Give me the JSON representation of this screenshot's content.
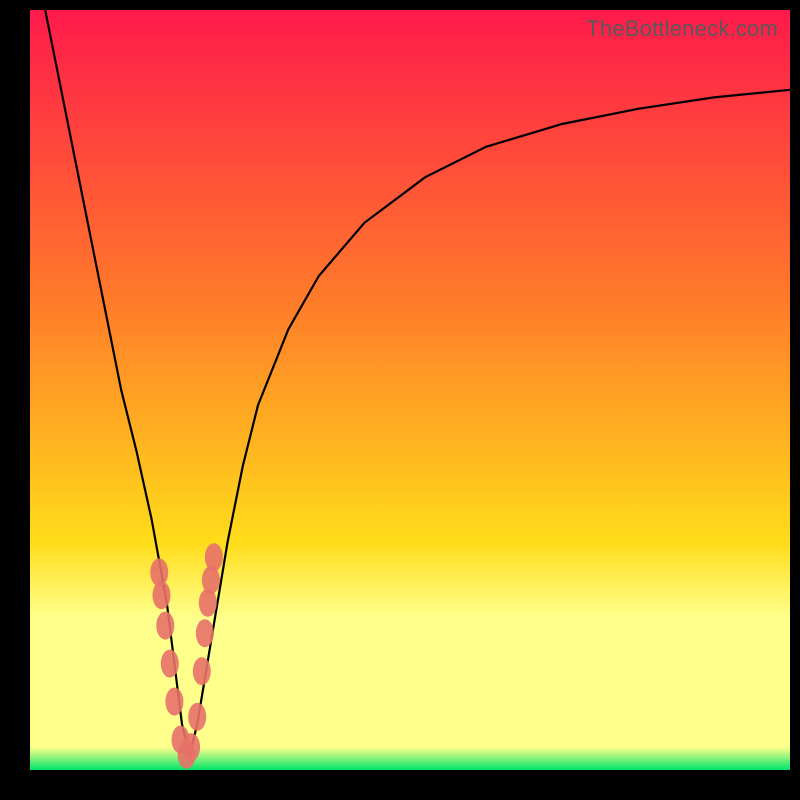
{
  "watermark": "TheBottleneck.com",
  "colors": {
    "top": "#ff1a4b",
    "mid_high": "#ff7a2a",
    "mid": "#ffdc1a",
    "pale_band": "#ffff8c",
    "bottom": "#00e56a",
    "frame": "#000000",
    "curve": "#000000",
    "marker": "#e77168"
  },
  "chart_data": {
    "type": "line",
    "title": "",
    "xlabel": "",
    "ylabel": "",
    "xlim": [
      0,
      100
    ],
    "ylim": [
      0,
      100
    ],
    "annotations": [
      "TheBottleneck.com"
    ],
    "series": [
      {
        "name": "bottleneck-curve",
        "x": [
          2,
          4,
          6,
          8,
          10,
          12,
          14,
          16,
          18,
          19,
          20,
          21,
          22,
          24,
          26,
          28,
          30,
          34,
          38,
          44,
          52,
          60,
          70,
          80,
          90,
          100
        ],
        "y": [
          100,
          90,
          80,
          70,
          60,
          50,
          42,
          33,
          22,
          14,
          6,
          2,
          6,
          18,
          30,
          40,
          48,
          58,
          65,
          72,
          78,
          82,
          85,
          87,
          88.5,
          89.5
        ]
      }
    ],
    "markers": {
      "name": "highlighted-points",
      "x": [
        17.0,
        17.3,
        17.8,
        18.4,
        19.0,
        19.8,
        20.6,
        21.2,
        22.0,
        22.6,
        23.0,
        23.4,
        23.8,
        24.2
      ],
      "y": [
        26,
        23,
        19,
        14,
        9,
        4,
        2,
        3,
        7,
        13,
        18,
        22,
        25,
        28
      ]
    },
    "background_bands": [
      {
        "from_y": 0,
        "to_y": 3,
        "color": "bottom"
      },
      {
        "from_y": 3,
        "to_y": 20,
        "color": "pale_band"
      },
      {
        "from_y": 20,
        "to_y": 100,
        "color": "gradient"
      }
    ]
  }
}
